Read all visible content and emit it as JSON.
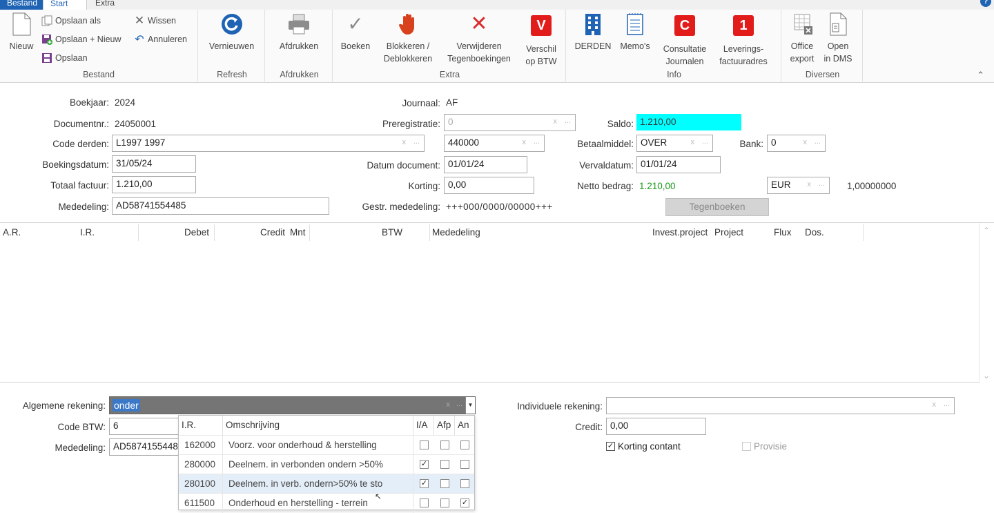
{
  "tabs": {
    "file": "Bestand",
    "start": "Start",
    "extra": "Extra"
  },
  "ribbon": {
    "bestand": {
      "new": "Nieuw",
      "save_as": "Opslaan als",
      "save_new": "Opslaan + Nieuw",
      "save": "Opslaan",
      "clear": "Wissen",
      "cancel": "Annuleren",
      "group": "Bestand"
    },
    "refresh": {
      "refresh": "Vernieuwen",
      "group": "Refresh"
    },
    "print": {
      "print": "Afdrukken",
      "group": "Afdrukken"
    },
    "extra": {
      "book": "Boeken",
      "block_l1": "Blokkeren /",
      "block_l2": "Deblokkeren",
      "delete_l1": "Verwijderen",
      "delete_l2": "Tegenboekingen",
      "diff_l1": "Verschil",
      "diff_l2": "op BTW",
      "group": "Extra",
      "diff_icon": "V"
    },
    "info": {
      "third": "DERDEN",
      "memo": "Memo's",
      "consult_l1": "Consultatie",
      "consult_l2": "Journalen",
      "deliv_l1": "Leverings-",
      "deliv_l2": "factuuradres",
      "group": "Info",
      "consult_icon": "C",
      "deliv_icon": "1"
    },
    "diversen": {
      "office_l1": "Office",
      "office_l2": "export",
      "dms_l1": "Open",
      "dms_l2": "in DMS",
      "group": "Diversen"
    }
  },
  "form": {
    "fiscal_year_label": "Boekjaar:",
    "fiscal_year": "2024",
    "doc_no_label": "Documentnr.:",
    "doc_no": "24050001",
    "third_code_label": "Code derden:",
    "third_code": "L1997 1997",
    "booking_date_label": "Boekingsdatum:",
    "booking_date": "31/05/24",
    "invoice_total_label": "Totaal factuur:",
    "invoice_total": "1.210,00",
    "message_label": "Mededeling:",
    "message": "AD58741554485",
    "journal_label": "Journaal:",
    "journal": "AF",
    "prereg_label": "Preregistratie:",
    "prereg": "0",
    "account": "440000",
    "doc_date_label": "Datum document:",
    "doc_date": "01/01/24",
    "discount_label": "Korting:",
    "discount": "0,00",
    "struct_msg_label": "Gestr. mededeling:",
    "struct_msg": "+++000/0000/00000+++",
    "balance_label": "Saldo:",
    "balance": "1.210,00",
    "payment_label": "Betaalmiddel:",
    "payment": "OVER",
    "bank_label": "Bank:",
    "bank": "0",
    "due_date_label": "Vervaldatum:",
    "due_date": "01/01/24",
    "net_label": "Netto  bedrag:",
    "net": "1.210,00",
    "currency": "EUR",
    "rate": "1,00000000",
    "counter_button": "Tegenboeken",
    "clear_x": "x",
    "dd": "..."
  },
  "grid": {
    "headers": [
      "A.R.",
      "I.R.",
      "Debet",
      "Credit",
      "Mnt",
      "BTW",
      "Mededeling",
      "Invest.project",
      "Project",
      "Flux",
      "Dos."
    ]
  },
  "bottom": {
    "gen_account_label": "Algemene rekening:",
    "gen_account": "onder",
    "vat_code_label": "Code BTW:",
    "vat_code": "6",
    "message_label": "Mededeling:",
    "message": "AD58741554485",
    "indiv_account_label": "Individuele rekening:",
    "indiv_account": "",
    "credit_label": "Credit:",
    "credit": "0,00",
    "cash_discount_label": "Korting contant",
    "commission_label": "Provisie"
  },
  "dropdown": {
    "headers": [
      "I.R.",
      "Omschrijving",
      "I/A",
      "Afp",
      "An"
    ],
    "rows": [
      {
        "ir": "162000",
        "desc": "Voorz. voor onderhoud & herstelling",
        "ia": false,
        "afp": false,
        "an": false
      },
      {
        "ir": "280000",
        "desc": "Deelnem. in verbonden ondern >50%",
        "ia": true,
        "afp": false,
        "an": false
      },
      {
        "ir": "280100",
        "desc": "Deelnem. in verb. ondern>50% te sto",
        "ia": true,
        "afp": false,
        "an": false
      },
      {
        "ir": "611500",
        "desc": "Onderhoud en herstelling -  terrein",
        "ia": false,
        "afp": false,
        "an": true
      }
    ]
  },
  "colors": {
    "accent": "#1e63b4",
    "balance_bg": "#00ffff",
    "net_green": "#1a9a1a",
    "selection": "#3b78c8"
  }
}
